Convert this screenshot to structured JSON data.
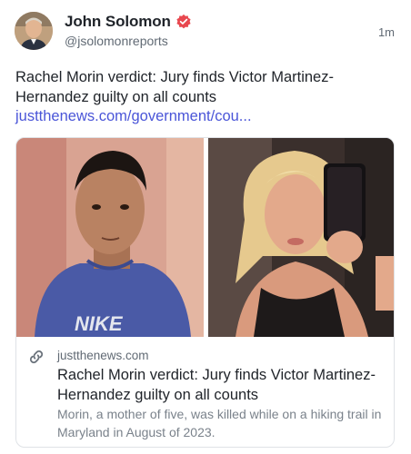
{
  "post": {
    "author_name": "John Solomon",
    "handle": "@jsolomonreports",
    "timestamp": "1m",
    "text": "Rachel Morin verdict: Jury finds Victor Martinez-Hernandez guilty on all counts",
    "link_text": "justthenews.com/government/cou..."
  },
  "card": {
    "domain": "justthenews.com",
    "title": "Rachel Morin verdict: Jury finds Victor Martinez-Hernandez guilty on all counts",
    "description": "Morin, a mother of five, was killed while on a hiking trail in Maryland in August of 2023.",
    "left_image_shirt_text": "NIKE"
  },
  "icons": {
    "verified": "verified-badge-icon",
    "link": "link-icon"
  },
  "colors": {
    "verified_badge": "#e8484f",
    "link": "#4a55d8",
    "text": "#1f2329",
    "muted": "#616a74"
  }
}
